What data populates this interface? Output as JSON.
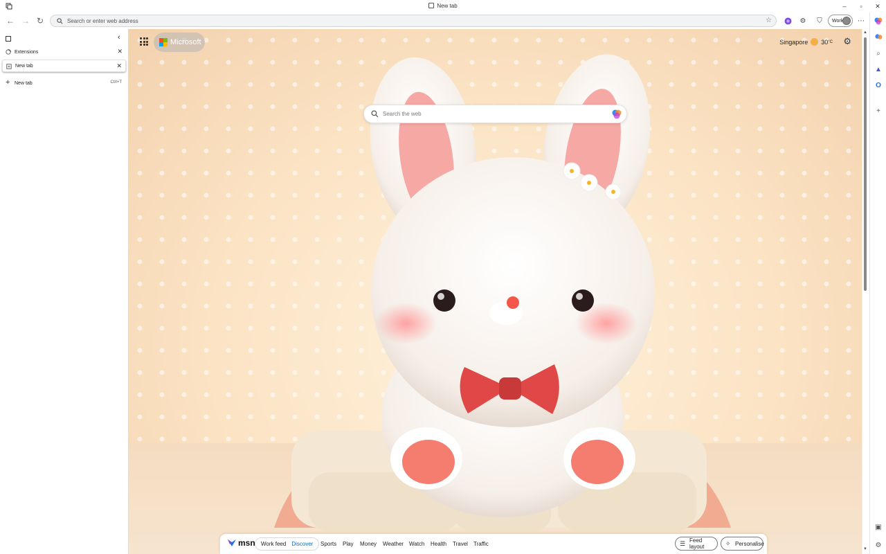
{
  "window": {
    "title": "New tab",
    "controls": [
      "–",
      "▫",
      "✕"
    ]
  },
  "toolbar": {
    "address_placeholder": "Search or enter web address",
    "profile_label": "Work"
  },
  "vertical_tabs": {
    "tabs": [
      {
        "label": "Extensions"
      },
      {
        "label": "New tab"
      }
    ],
    "new_tab_label": "New tab",
    "new_tab_shortcut": "Ctrl+T"
  },
  "newtab_page": {
    "brand": "Microsoft",
    "weather_location": "Singapore",
    "weather_temp": "30",
    "weather_unit": "°C",
    "search_placeholder": "Search the web"
  },
  "feed": {
    "brand": "msn",
    "segments": [
      "Work feed",
      "Discover"
    ],
    "active_segment": "Discover",
    "links": [
      "Sports",
      "Play",
      "Money",
      "Weather",
      "Watch",
      "Health",
      "Travel",
      "Traffic"
    ],
    "feed_layout_label": "Feed layout",
    "personalise_label": "Personalise"
  },
  "colors": {
    "accent": "#0f6cbd",
    "background_peach": "#fbe3c4",
    "bow_red": "#e04848"
  },
  "icons": {
    "back": "arrow-left-icon",
    "forward": "arrow-right-icon",
    "refresh": "refresh-icon",
    "search": "search-icon",
    "favorite": "star-icon",
    "copilot": "copilot-icon",
    "settings": "gear-icon"
  }
}
